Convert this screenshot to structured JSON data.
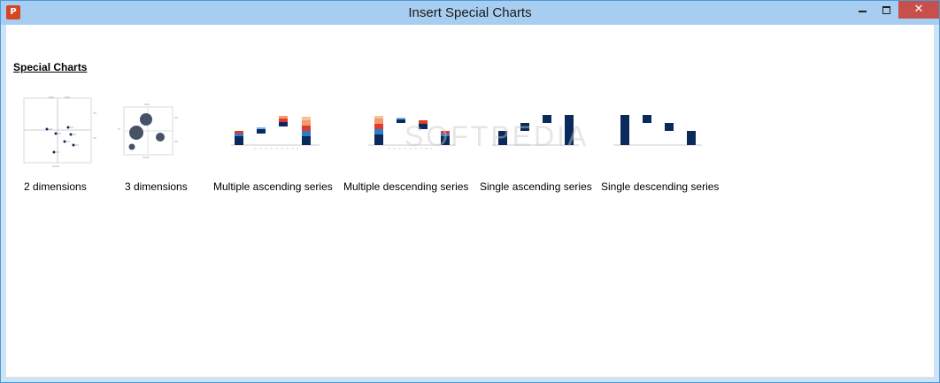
{
  "window": {
    "title": "Insert Special Charts",
    "app_icon": "powerpoint-icon",
    "controls": {
      "minimize_icon": "minimize-icon",
      "maximize_icon": "maximize-icon",
      "close_icon": "close-icon",
      "close_glyph": "✕"
    }
  },
  "section": {
    "title": "Special Charts"
  },
  "charts": [
    {
      "label": "2 dimensions"
    },
    {
      "label": "3 dimensions"
    },
    {
      "label": "Multiple ascending series"
    },
    {
      "label": "Multiple descending series"
    },
    {
      "label": "Single ascending series"
    },
    {
      "label": "Single descending series"
    }
  ],
  "watermark": "SOFTPEDIA",
  "colors": {
    "titlebar": "#a7cdf0",
    "close_button": "#c7504c",
    "navy": "#0b2a5c",
    "orange": "#f39c6b",
    "red": "#e03a2f",
    "blue": "#2e7dc9",
    "light_blue": "#6fb3e8"
  }
}
